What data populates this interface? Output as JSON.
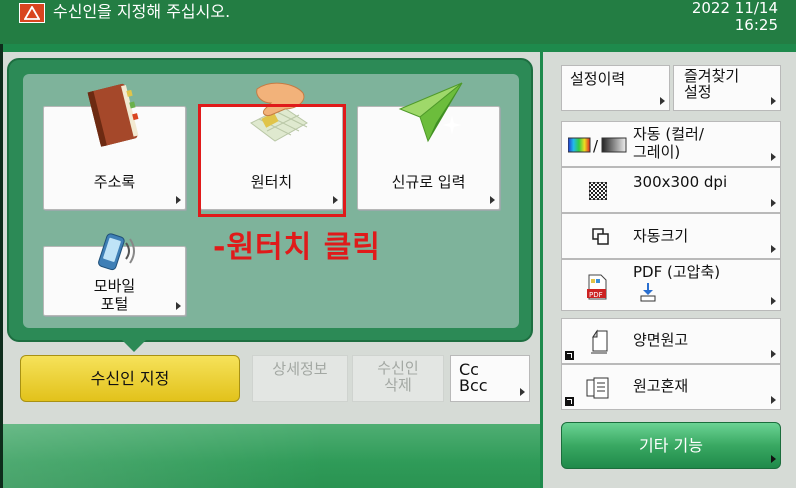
{
  "status_bar": {
    "message": "수신인을 지정해 주십시오.",
    "date": "2022 11/14",
    "time": "16:25"
  },
  "destination_panel": {
    "tiles": [
      {
        "label": "주소록",
        "icon": "address-book-icon"
      },
      {
        "label": "원터치",
        "icon": "one-touch-hand-icon"
      },
      {
        "label": "신규로 입력",
        "icon": "paper-plane-icon"
      },
      {
        "label_line1": "모바일",
        "label_line2": "포털",
        "icon": "mobile-phone-icon"
      }
    ],
    "annotation": "-원터치 클릭"
  },
  "actions": {
    "specify_destination": "수신인 지정",
    "details_line1": "상세정보",
    "delete_line1": "수신인",
    "delete_line2": "삭제",
    "cc_line1": "Cc",
    "cc_line2": "Bcc"
  },
  "right_panel": {
    "history": "설정이력",
    "favorites_line1": "즐겨찾기",
    "favorites_line2": "설정",
    "color_mode_line1": "자동 (컬러/",
    "color_mode_line2": "그레이)",
    "resolution": "300x300 dpi",
    "size": "자동크기",
    "file_format": "PDF (고압축)",
    "duplex": "양면원고",
    "mixed": "원고혼재",
    "other_functions": "기타 기능"
  },
  "colors": {
    "accent_green": "#1e8a4c",
    "highlight_red": "#e01a1a",
    "primary_button_yellow": "#e9cb2a"
  }
}
